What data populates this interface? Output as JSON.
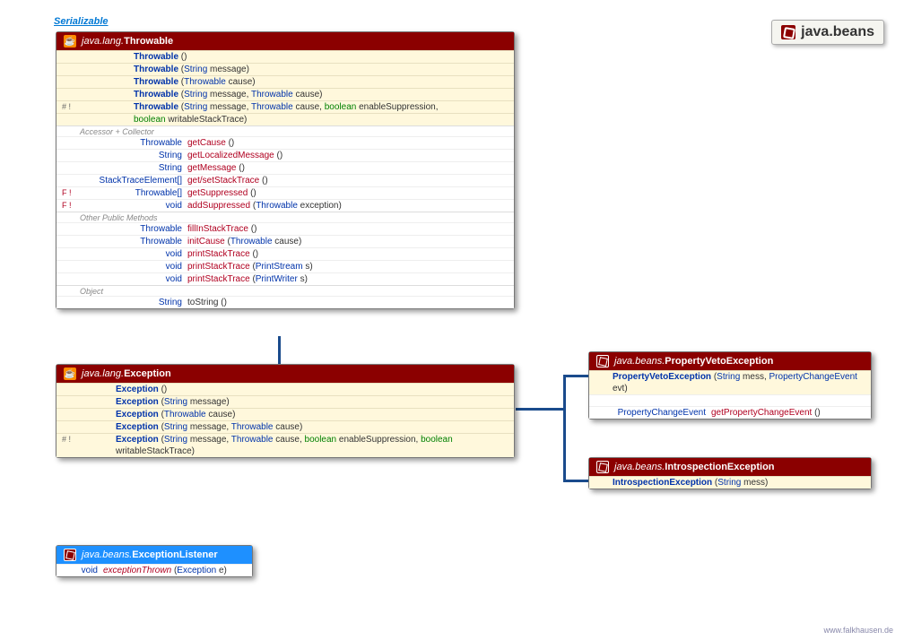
{
  "interfaceLabel": "Serializable",
  "packageBadge": "java.beans",
  "footer": "www.falkhausen.de",
  "throwable": {
    "pkg": "java.lang.",
    "name": "Throwable",
    "ctors": [
      {
        "marker": "",
        "name": "Throwable",
        "params": "()"
      },
      {
        "marker": "",
        "name": "Throwable",
        "params": "(String message)"
      },
      {
        "marker": "",
        "name": "Throwable",
        "params": "(Throwable cause)"
      },
      {
        "marker": "",
        "name": "Throwable",
        "params": "(String message, Throwable cause)"
      },
      {
        "marker": "# !",
        "name": "Throwable",
        "params": "(String message, Throwable cause, boolean enableSuppression,",
        "cont": "boolean writableStackTrace)"
      }
    ],
    "secAccessor": "Accessor + Collector",
    "accessors": [
      {
        "marker": "",
        "ret": "Throwable",
        "name": "getCause",
        "params": "()"
      },
      {
        "marker": "",
        "ret": "String",
        "name": "getLocalizedMessage",
        "params": "()"
      },
      {
        "marker": "",
        "ret": "String",
        "name": "getMessage",
        "params": "()"
      },
      {
        "marker": "",
        "ret": "StackTraceElement[]",
        "name": "get/setStackTrace",
        "params": "()"
      },
      {
        "marker": "F !",
        "ret": "Throwable[]",
        "name": "getSuppressed",
        "params": "()"
      },
      {
        "marker": "F !",
        "ret": "void",
        "name": "addSuppressed",
        "params": "(Throwable exception)"
      }
    ],
    "secOther": "Other Public Methods",
    "others": [
      {
        "marker": "",
        "ret": "Throwable",
        "name": "fillInStackTrace",
        "params": "()"
      },
      {
        "marker": "",
        "ret": "Throwable",
        "name": "initCause",
        "params": "(Throwable cause)"
      },
      {
        "marker": "",
        "ret": "void",
        "name": "printStackTrace",
        "params": "()"
      },
      {
        "marker": "",
        "ret": "void",
        "name": "printStackTrace",
        "params": "(PrintStream s)"
      },
      {
        "marker": "",
        "ret": "void",
        "name": "printStackTrace",
        "params": "(PrintWriter s)"
      }
    ],
    "secObject": "Object",
    "objmethods": [
      {
        "marker": "",
        "ret": "String",
        "name": "toString",
        "params": "()"
      }
    ]
  },
  "exception": {
    "pkg": "java.lang.",
    "name": "Exception",
    "ctors": [
      {
        "marker": "",
        "name": "Exception",
        "params": "()"
      },
      {
        "marker": "",
        "name": "Exception",
        "params": "(String message)"
      },
      {
        "marker": "",
        "name": "Exception",
        "params": "(Throwable cause)"
      },
      {
        "marker": "",
        "name": "Exception",
        "params": "(String message, Throwable cause)"
      },
      {
        "marker": "# !",
        "name": "Exception",
        "params": "(String message, Throwable cause, boolean enableSuppression, boolean writableStackTrace)"
      }
    ]
  },
  "propertyVeto": {
    "pkg": "java.beans.",
    "name": "PropertyVetoException",
    "ctor": {
      "name": "PropertyVetoException",
      "params": "(String mess, PropertyChangeEvent evt)"
    },
    "method": {
      "ret": "PropertyChangeEvent",
      "name": "getPropertyChangeEvent",
      "params": "()"
    }
  },
  "introspection": {
    "pkg": "java.beans.",
    "name": "IntrospectionException",
    "ctor": {
      "name": "IntrospectionException",
      "params": "(String mess)"
    }
  },
  "exceptionListener": {
    "pkg": "java.beans.",
    "name": "ExceptionListener",
    "method": {
      "ret": "void",
      "name": "exceptionThrown",
      "params": "(Exception e)"
    }
  }
}
